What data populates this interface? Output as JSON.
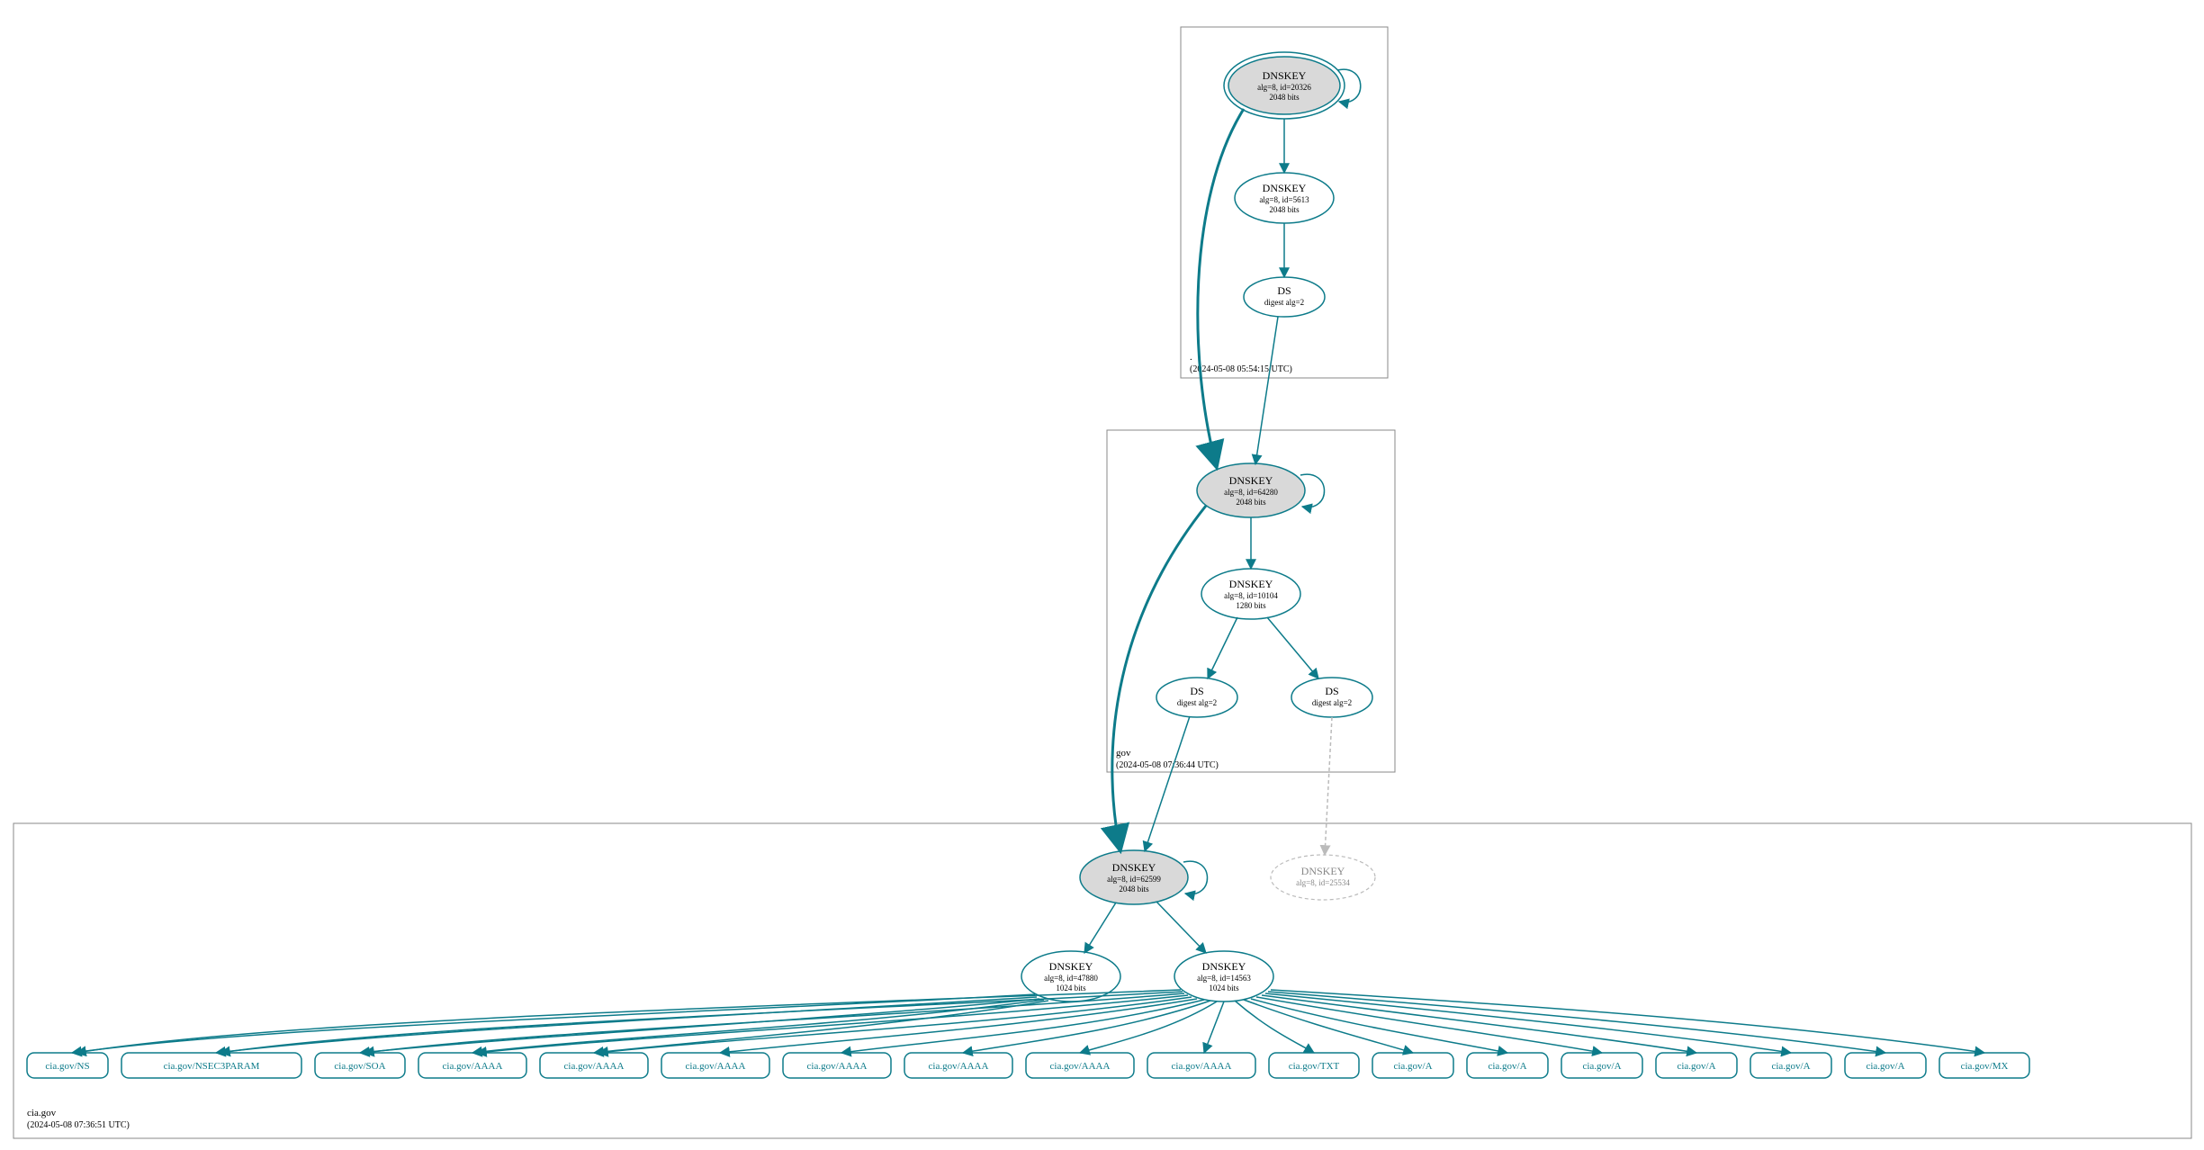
{
  "zones": {
    "root": {
      "label": ".",
      "ts": "(2024-05-08 05:54:15 UTC)",
      "ksk": {
        "title": "DNSKEY",
        "sub1": "alg=8, id=20326",
        "sub2": "2048 bits"
      },
      "zsk": {
        "title": "DNSKEY",
        "sub1": "alg=8, id=5613",
        "sub2": "2048 bits"
      },
      "ds": {
        "title": "DS",
        "sub1": "digest alg=2"
      }
    },
    "gov": {
      "label": "gov",
      "ts": "(2024-05-08 07:36:44 UTC)",
      "ksk": {
        "title": "DNSKEY",
        "sub1": "alg=8, id=64280",
        "sub2": "2048 bits"
      },
      "zsk": {
        "title": "DNSKEY",
        "sub1": "alg=8, id=10104",
        "sub2": "1280 bits"
      },
      "dsL": {
        "title": "DS",
        "sub1": "digest alg=2"
      },
      "dsR": {
        "title": "DS",
        "sub1": "digest alg=2"
      }
    },
    "cia": {
      "label": "cia.gov",
      "ts": "(2024-05-08 07:36:51 UTC)",
      "ksk": {
        "title": "DNSKEY",
        "sub1": "alg=8, id=62599",
        "sub2": "2048 bits"
      },
      "ghost": {
        "title": "DNSKEY",
        "sub1": "alg=8, id=25534"
      },
      "zskL": {
        "title": "DNSKEY",
        "sub1": "alg=8, id=47880",
        "sub2": "1024 bits"
      },
      "zskR": {
        "title": "DNSKEY",
        "sub1": "alg=8, id=14563",
        "sub2": "1024 bits"
      }
    }
  },
  "rr": {
    "r0": "cia.gov/NS",
    "r1": "cia.gov/NSEC3PARAM",
    "r2": "cia.gov/SOA",
    "r3": "cia.gov/AAAA",
    "r4": "cia.gov/AAAA",
    "r5": "cia.gov/AAAA",
    "r6": "cia.gov/AAAA",
    "r7": "cia.gov/AAAA",
    "r8": "cia.gov/AAAA",
    "r9": "cia.gov/AAAA",
    "r10": "cia.gov/TXT",
    "r11": "cia.gov/A",
    "r12": "cia.gov/A",
    "r13": "cia.gov/A",
    "r14": "cia.gov/A",
    "r15": "cia.gov/A",
    "r16": "cia.gov/A",
    "r17": "cia.gov/MX"
  }
}
